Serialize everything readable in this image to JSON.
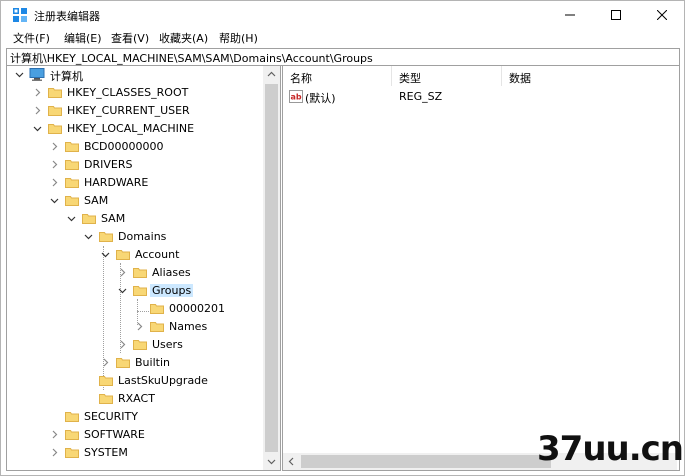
{
  "window": {
    "title": "注册表编辑器"
  },
  "menu": [
    "文件(F)",
    "编辑(E)",
    "查看(V)",
    "收藏夹(A)",
    "帮助(H)"
  ],
  "address": "计算机\\HKEY_LOCAL_MACHINE\\SAM\\SAM\\Domains\\Account\\Groups",
  "tree": {
    "root": "计算机",
    "hkcr": "HKEY_CLASSES_ROOT",
    "hkcu": "HKEY_CURRENT_USER",
    "hklm": "HKEY_LOCAL_MACHINE",
    "bcd": "BCD00000000",
    "drivers": "DRIVERS",
    "hardware": "HARDWARE",
    "sam": "SAM",
    "sam2": "SAM",
    "domains": "Domains",
    "account": "Account",
    "aliases": "Aliases",
    "groups": "Groups",
    "g00000201": "00000201",
    "names": "Names",
    "users": "Users",
    "builtin": "Builtin",
    "lastsku": "LastSkuUpgrade",
    "rxact": "RXACT",
    "security": "SECURITY",
    "software": "SOFTWARE",
    "system": "SYSTEM"
  },
  "columns": {
    "name": "名称",
    "type": "类型",
    "data": "数据"
  },
  "values": [
    {
      "name": "(默认)",
      "type": "REG_SZ",
      "data": "",
      "icon": "string-value-icon"
    }
  ],
  "watermark": "37uu.cn",
  "colors": {
    "selection": "#cce8ff",
    "folder": "#f8d775",
    "folder_dark": "#e0b24a"
  }
}
